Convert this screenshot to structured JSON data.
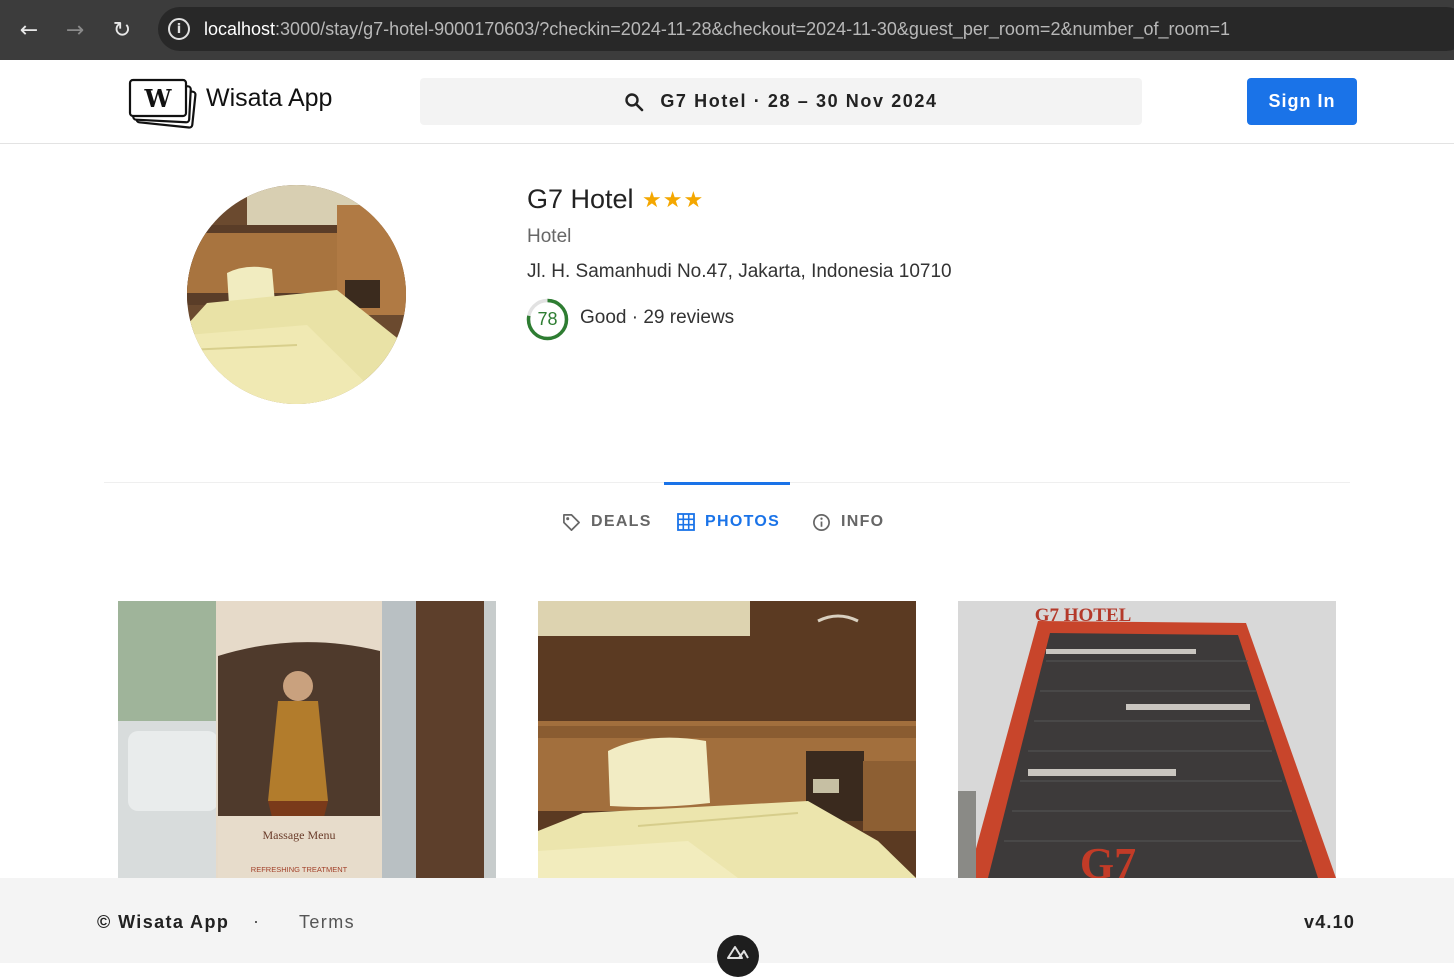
{
  "browser": {
    "url_host": "localhost",
    "url_path": ":3000/stay/g7-hotel-9000170603/?checkin=2024-11-28&checkout=2024-11-30&guest_per_room=2&number_of_room=1",
    "icons": [
      "back-arrow-icon",
      "forward-arrow-icon",
      "reload-icon",
      "info-icon"
    ]
  },
  "header": {
    "brand": "Wisata App",
    "search_summary": "G7 Hotel · 28 – 30 Nov 2024",
    "signin_label": "Sign In"
  },
  "hotel": {
    "name": "G7 Hotel",
    "stars": "★★★",
    "star_count": 3,
    "type": "Hotel",
    "address": "Jl. H. Samanhudi No.47, Jakarta, Indonesia 10710",
    "rating_score": "78",
    "rating_fraction": 0.78,
    "rating_summary": "Good · 29 reviews",
    "rating_color": "#2e7d32"
  },
  "tabs": [
    {
      "label": "DEALS",
      "icon": "tag-icon",
      "active": false
    },
    {
      "label": "PHOTOS",
      "icon": "grid-icon",
      "active": true
    },
    {
      "label": "INFO",
      "icon": "info-icon",
      "active": false
    }
  ],
  "photos": [
    {
      "subject": "spa-banner",
      "banner_lines": [
        "Massage Menu",
        "REFRESHING TREATMENT"
      ]
    },
    {
      "subject": "hotel-room-beds"
    },
    {
      "subject": "hotel-building",
      "sign_text": "G7 HOTEL"
    }
  ],
  "footer": {
    "copyright": "© Wisata App",
    "separator": "·",
    "terms": "Terms",
    "version": "v4.10"
  },
  "colors": {
    "accent": "#1a73e8",
    "star": "#f4a700",
    "rating": "#2e7d32"
  }
}
